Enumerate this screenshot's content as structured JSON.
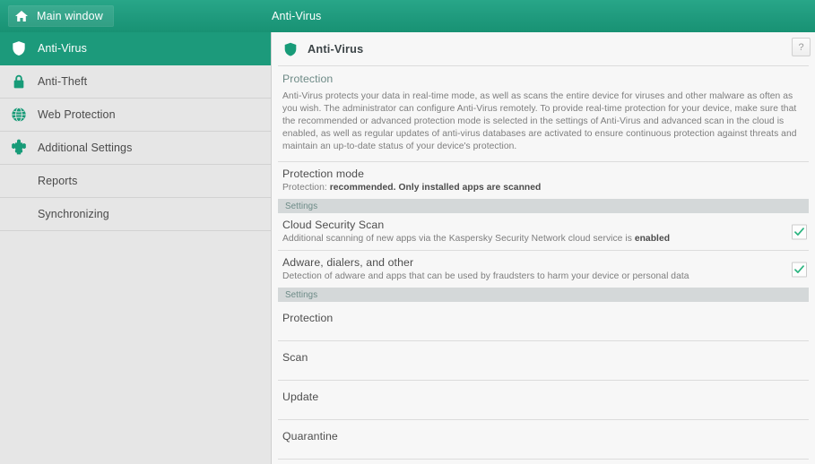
{
  "colors": {
    "brand_green": "#1c9a7b",
    "topbar_green": "#20a07f",
    "sidebar_bg": "#e6e6e6",
    "panel_bg": "#f7f7f7",
    "settings_bar_bg": "#d4d8d9",
    "check_green": "#2ab47f",
    "heading_teal": "#6d8a86"
  },
  "topbar": {
    "home_label": "Main window",
    "home_icon": "home-icon",
    "title": "Anti-Virus"
  },
  "sidebar": {
    "items": [
      {
        "label": "Anti-Virus",
        "icon": "shield-icon",
        "selected": true,
        "sub": false
      },
      {
        "label": "Anti-Theft",
        "icon": "lock-icon",
        "selected": false,
        "sub": false
      },
      {
        "label": "Web Protection",
        "icon": "globe-icon",
        "selected": false,
        "sub": false
      },
      {
        "label": "Additional Settings",
        "icon": "puzzle-icon",
        "selected": false,
        "sub": false
      },
      {
        "label": "Reports",
        "icon": "",
        "selected": false,
        "sub": true
      },
      {
        "label": "Synchronizing",
        "icon": "",
        "selected": false,
        "sub": true
      }
    ]
  },
  "main": {
    "header": {
      "icon": "shield-icon",
      "title": "Anti-Virus",
      "help_label": "?"
    },
    "protection_section": {
      "heading": "Protection",
      "body": "Anti-Virus protects your data in real-time mode, as well as scans the entire device for viruses and other malware as often as you wish. The administrator can configure Anti-Virus remotely. To provide real-time protection for your device, make sure that the recommended or advanced protection mode is selected in the settings of Anti-Virus and advanced scan in the cloud is enabled, as well as regular updates of anti-virus databases are activated to ensure continuous protection against threats and maintain an up-to-date status of your device's protection."
    },
    "protection_mode": {
      "title": "Protection mode",
      "sub_prefix": "Protection: ",
      "sub_bold": "recommended. Only installed apps are scanned"
    },
    "settings_bar_1": "Settings",
    "toggle_rows": [
      {
        "title": "Cloud Security Scan",
        "sub_prefix": "Additional scanning of new apps via the Kaspersky Security Network cloud service is ",
        "sub_bold": "enabled",
        "checked": true
      },
      {
        "title": "Adware, dialers, and other",
        "sub_prefix": "Detection of adware and apps that can be used by fraudsters to harm your device or personal data",
        "sub_bold": "",
        "checked": true
      }
    ],
    "settings_bar_2": "Settings",
    "menu_rows": [
      {
        "label": "Protection"
      },
      {
        "label": "Scan"
      },
      {
        "label": "Update"
      },
      {
        "label": "Quarantine"
      }
    ]
  }
}
